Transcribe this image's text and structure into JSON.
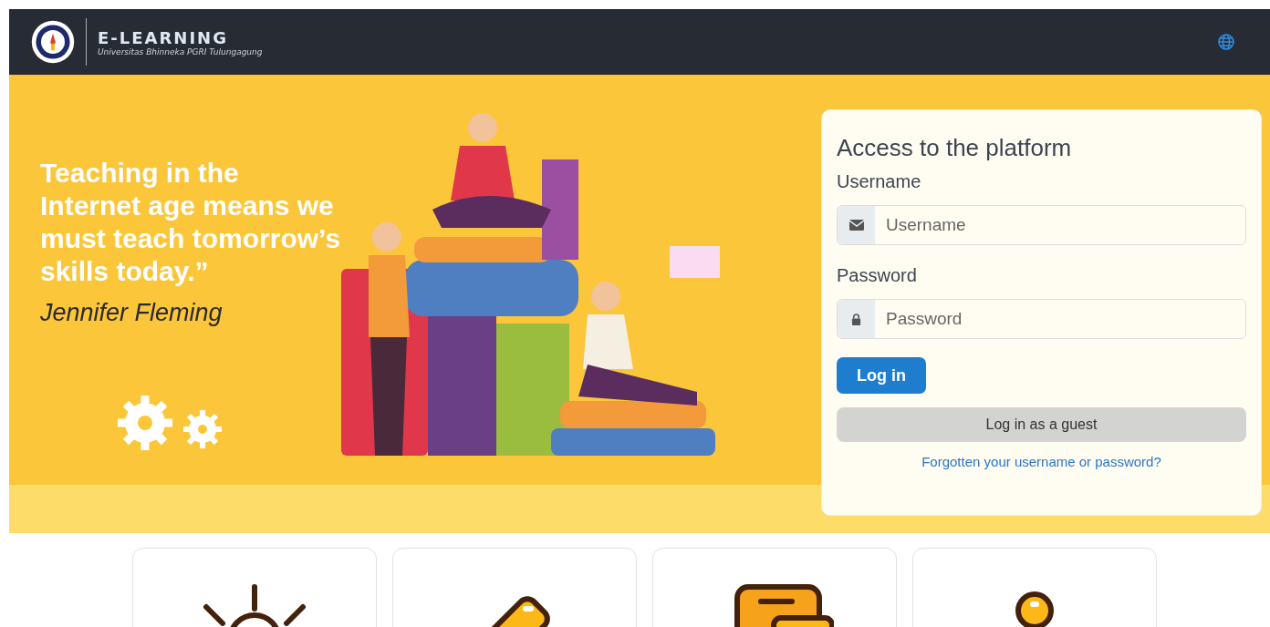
{
  "header": {
    "brand": "E-LEARNING",
    "subtitle": "Universitas Bhinneka PGRI Tulungagung"
  },
  "hero": {
    "quote": "Teaching in the Internet age means we must teach tomorrow’s skills today.”",
    "author": "Jennifer Fleming"
  },
  "login": {
    "title": "Access to the platform",
    "username_label": "Username",
    "username_placeholder": "Username",
    "password_label": "Password",
    "password_placeholder": "Password",
    "login_button": "Log in",
    "guest_button": "Log in as a guest",
    "forgot_link": "Forgotten your username or password?"
  },
  "features": [
    {
      "kind": "bulb"
    },
    {
      "kind": "tag"
    },
    {
      "kind": "chat"
    },
    {
      "kind": "pin"
    }
  ]
}
